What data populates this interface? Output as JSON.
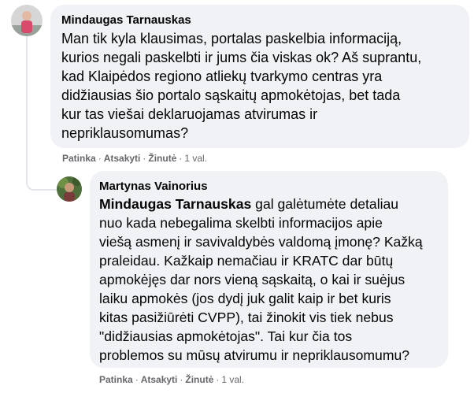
{
  "comments": [
    {
      "author": "Mindaugas Tarnauskas",
      "text_lines": [
        "Man tik kyla klausimas, portalas paskelbia informaciją,",
        "kurios negali paskelbti ir jums čia viskas ok? Aš suprantu,",
        "kad Klaipėdos regiono atliekų tvarkymo centras yra",
        "didžiausias šio portalo sąskaitų apmokėtojas, bet tada",
        "kur tas viešai deklaruojamas atvirumas ir",
        "nepriklausomumas?"
      ],
      "actions": {
        "like": "Patinka",
        "reply": "Atsakyti",
        "share": "Žinutė",
        "time": "1 val."
      },
      "avatar_colors": {
        "bg": "#c9c9c9",
        "body": "#d94a6b"
      }
    },
    {
      "author": "Martynas Vainorius",
      "mention": "Mindaugas Tarnauskas",
      "text_first_line_rest": " gal galėtumėte detaliau",
      "text_lines": [
        "nuo kada nebegalima skelbti informacijos apie",
        "viešą asmenį ir savivaldybės valdomą įmonę? Kažką",
        "praleidau. Kažkaip nemačiau ir KRATC dar būtų",
        "apmokėjęs dar nors vieną sąskaitą, o kai ir suėjus",
        "laiku apmokės (jos dydį juk galit kaip ir bet kuris",
        "kitas pasižiūrėti CVPP), tai žinokit vis tiek nebus",
        "\"didžiausias apmokėtojas\". Tai kur čia tos",
        "problemos su mūsų atvirumu ir nepriklausomumu?"
      ],
      "actions": {
        "like": "Patinka",
        "reply": "Atsakyti",
        "share": "Žinutė",
        "time": "1 val."
      },
      "avatar_colors": {
        "bg": "#4f6f3a",
        "face": "#c79a7a"
      }
    }
  ],
  "separator": "·"
}
